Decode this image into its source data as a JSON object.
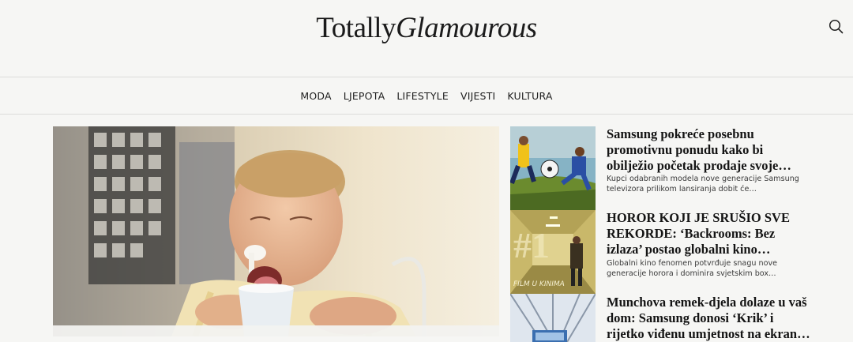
{
  "header": {
    "logo_part1": "Totally",
    "logo_part2": "Glamourous"
  },
  "icons": {
    "search": "search-icon"
  },
  "nav": {
    "items": [
      "MODA",
      "LJEPOTA",
      "LIFESTYLE",
      "VIJESTI",
      "KULTURA"
    ]
  },
  "articles": [
    {
      "title": "Samsung pokreće posebnu promotivnu ponudu kako bi obilježio početak prodaje svoje…",
      "excerpt": "Kupci odabranih modela nove generacije Samsung televizora prilikom lansiranja dobit će…"
    },
    {
      "title": "HOROR KOJI JE SRUŠIO SVE REKORDE: ‘Backrooms: Bez izlaza’ postao globalni kino…",
      "excerpt": "Globalni kino fenomen potvrđuje snagu nove generacije horora i dominira svjetskim box…",
      "image_text": "FILM U KINIMA"
    },
    {
      "title": "Munchova remek-djela dolaze u vaš dom: Samsung donosi ‘Krik’ i rijetko viđenu umjetnost na ekran…"
    }
  ]
}
